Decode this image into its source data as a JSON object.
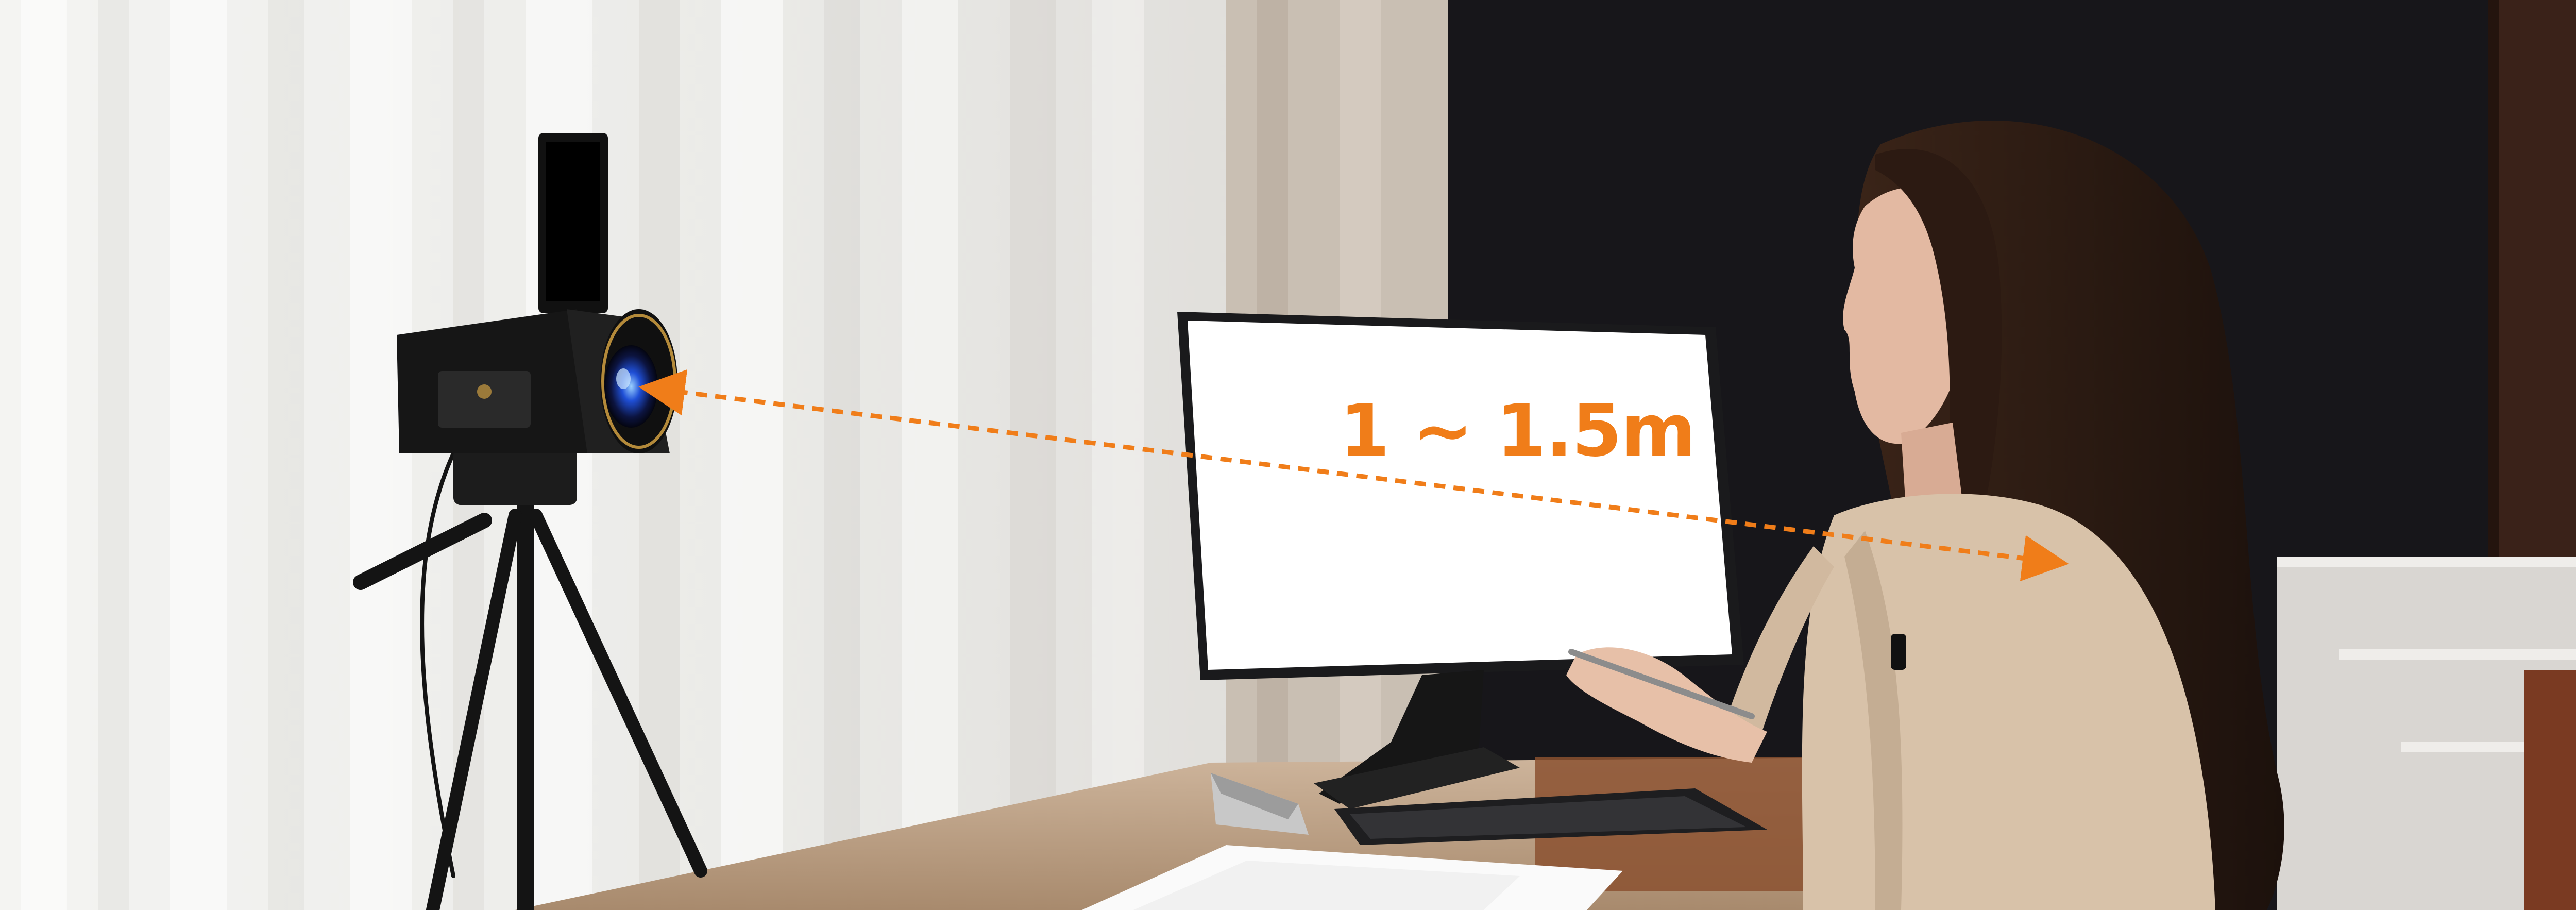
{
  "scene": {
    "distance_label": "1 ~ 1.5m",
    "colors": {
      "accent": "#f07d19",
      "wall_dark": "#17161a",
      "curtain": "#eeeeeb",
      "desk": "#b8987a",
      "blazer": "#d8c2a9",
      "hair": "#2a1a14",
      "screen": "#ffffff"
    },
    "objects": [
      "camera",
      "tripod",
      "monitor",
      "keyboard",
      "person",
      "curtain",
      "desk",
      "stapler",
      "papers"
    ]
  }
}
